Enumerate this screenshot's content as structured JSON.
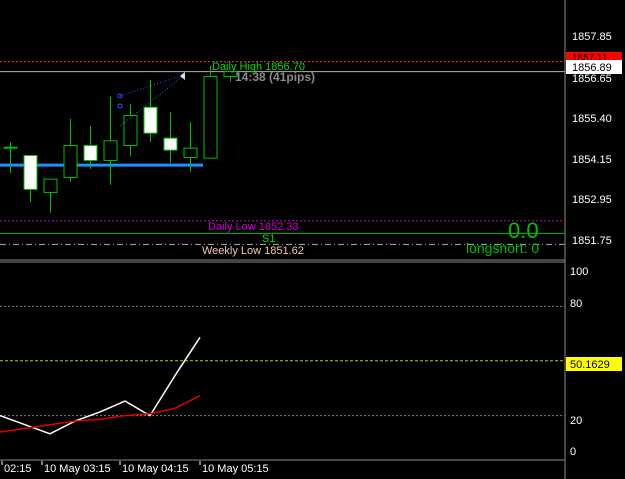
{
  "chart_data": [
    {
      "type": "candlestick",
      "price_scale": {
        "ticks": [
          "1857.85",
          "1855.40",
          "1854.15",
          "1852.95",
          "1851.75"
        ],
        "current_price": "1856.89",
        "partial_label": "1856.65",
        "top_red_label": "1857.11"
      },
      "time_axis": {
        "labels": [
          "02:15",
          "10 May 03:15",
          "10 May 04:15",
          "10 May 05:15"
        ]
      },
      "candles": [
        {
          "open": 1854.54,
          "high": 1854.69,
          "low": 1853.76,
          "close": 1854.54
        },
        {
          "open": 1854.29,
          "high": 1854.29,
          "low": 1852.89,
          "close": 1853.27
        },
        {
          "open": 1853.18,
          "high": 1853.49,
          "low": 1852.57,
          "close": 1853.58
        },
        {
          "open": 1853.63,
          "high": 1855.39,
          "low": 1853.49,
          "close": 1854.59
        },
        {
          "open": 1854.59,
          "high": 1855.18,
          "low": 1853.89,
          "close": 1854.14
        },
        {
          "open": 1854.14,
          "high": 1856.05,
          "low": 1853.41,
          "close": 1854.73
        },
        {
          "open": 1854.59,
          "high": 1855.84,
          "low": 1854.27,
          "close": 1855.49
        },
        {
          "open": 1855.74,
          "high": 1856.56,
          "low": 1854.69,
          "close": 1854.96
        },
        {
          "open": 1854.81,
          "high": 1855.59,
          "low": 1854.06,
          "close": 1854.45
        },
        {
          "open": 1854.23,
          "high": 1855.29,
          "low": 1853.81,
          "close": 1854.51
        },
        {
          "open": 1854.21,
          "high": 1856.99,
          "low": 1854.21,
          "close": 1856.66
        },
        {
          "open": 1856.66,
          "high": 1856.81,
          "low": 1856.51,
          "close": 1856.81
        }
      ],
      "levels": [
        {
          "name": "Daily High",
          "label": "Daily High 1856.70",
          "value": 1856.7,
          "color": "#00e000"
        },
        {
          "name": "S1",
          "label": "S1",
          "value": 1851.95,
          "color": "#00e000"
        },
        {
          "name": "Daily Low",
          "label": "Daily Low 1852.33",
          "value": 1852.33,
          "color": "#d000d0"
        },
        {
          "name": "Weekly Low",
          "label": "Weekly Low 1851.62",
          "value": 1851.62,
          "color": "#f0c8b0"
        }
      ],
      "blue_level": 1854.0,
      "annotations": {
        "timer": "14:38 (41pips)",
        "big_value": "0.0",
        "long_short": "longshort: 0"
      }
    },
    {
      "type": "line",
      "y_ticks": [
        "100",
        "80",
        "20",
        "0"
      ],
      "current_value": "50.1629",
      "level_value": 50.1629,
      "ylim": [
        0,
        100
      ],
      "series": [
        {
          "color": "#ffffff",
          "values": [
            20,
            15,
            10,
            17,
            22,
            28,
            20,
            42,
            63
          ]
        },
        {
          "color": "#e00000",
          "values": [
            11,
            13,
            15,
            17,
            18,
            20,
            21,
            24,
            31
          ]
        }
      ]
    }
  ],
  "colors": {
    "background": "#000000",
    "grid": "#808080",
    "bull": "#00c000",
    "bear_body": "#ffffff",
    "blue_line": "#1e90ff",
    "level_line": "#c8c800",
    "axis_text": "#ffffff",
    "accent_green": "#00e000"
  }
}
